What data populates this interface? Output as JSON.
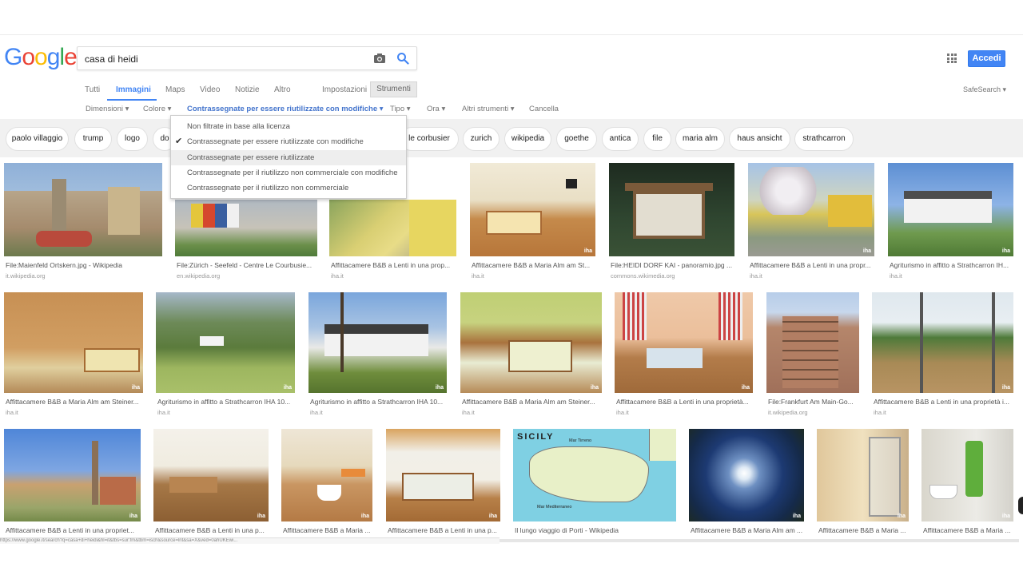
{
  "logo": {
    "text": "Google"
  },
  "search": {
    "value": "casa di heidi"
  },
  "header": {
    "signin_label": "Accedi"
  },
  "tabs": [
    {
      "label": "Tutti"
    },
    {
      "label": "Immagini"
    },
    {
      "label": "Maps"
    },
    {
      "label": "Video"
    },
    {
      "label": "Notizie"
    },
    {
      "label": "Altro"
    },
    {
      "label": "Impostazioni"
    },
    {
      "label": "Strumenti"
    }
  ],
  "safesearch": "SafeSearch ▾",
  "tools": {
    "dimensioni": "Dimensioni ▾",
    "colore": "Colore ▾",
    "license": "Contrassegnate per essere riutilizzate con modifiche ▾",
    "tipo": "Tipo ▾",
    "ora": "Ora ▾",
    "altri": "Altri strumenti ▾",
    "cancella": "Cancella"
  },
  "chips": [
    "paolo villaggio",
    "trump",
    "logo",
    "do",
    "le corbusier",
    "zurich",
    "wikipedia",
    "goethe",
    "antica",
    "file",
    "maria alm",
    "haus ansicht",
    "strathcarron"
  ],
  "dropdown": {
    "items": [
      "Non filtrate in base alla licenza",
      "Contrassegnate per essere riutilizzate con modifiche",
      "Contrassegnate per essere riutilizzate",
      "Contrassegnate per il riutilizzo non commerciale con modifiche",
      "Contrassegnate per il riutilizzo non commerciale"
    ],
    "checked_index": 1,
    "hover_index": 2
  },
  "results": [
    {
      "caption": "File:Maienfeld Ortskern.jpg - Wikipedia",
      "source": "it.wikipedia.org"
    },
    {
      "caption": "File:Zürich - Seefeld - Centre Le Courbusie...",
      "source": "en.wikipedia.org"
    },
    {
      "caption": "Affittacamere B&B a Lenti in una prop...",
      "source": "iha.it"
    },
    {
      "caption": "Affittacamere B&B a Maria Alm am St...",
      "source": "iha.it"
    },
    {
      "caption": "File:HEIDI DORF KAI - panoramio.jpg ...",
      "source": "commons.wikimedia.org"
    },
    {
      "caption": "Affittacamere B&B a Lenti in una propr...",
      "source": "iha.it"
    },
    {
      "caption": "Agriturismo in affitto a Strathcarron IH...",
      "source": "iha.it"
    },
    {
      "caption": "Affittacamere B&B a Maria Alm am Steiner...",
      "source": "iha.it"
    },
    {
      "caption": "Agriturismo in affitto a Strathcarron IHA 10...",
      "source": "iha.it"
    },
    {
      "caption": "Agriturismo in affitto a Strathcarron IHA 10...",
      "source": "iha.it"
    },
    {
      "caption": "Affittacamere B&B a Maria Alm am Steiner...",
      "source": "iha.it"
    },
    {
      "caption": "Affittacamere B&B a Lenti in una proprietà...",
      "source": "iha.it"
    },
    {
      "caption": "File:Frankfurt Am Main-Go...",
      "source": "it.wikipedia.org"
    },
    {
      "caption": "Affittacamere B&B a Lenti in una proprietà i...",
      "source": "iha.it"
    },
    {
      "caption": "Affittacamere B&B a Lenti in una propriet...",
      "source": ""
    },
    {
      "caption": "Affittacamere B&B a Lenti in una p...",
      "source": ""
    },
    {
      "caption": "Affittacamere B&B a Maria ...",
      "source": ""
    },
    {
      "caption": "Affittacamere B&B a Lenti in una p...",
      "source": ""
    },
    {
      "caption": "Il lungo viaggio di Porti - Wikipedia",
      "source": ""
    },
    {
      "caption": "Affittacamere B&B a Maria Alm am ...",
      "source": ""
    },
    {
      "caption": "Affittacamere B&B a Maria ...",
      "source": ""
    },
    {
      "caption": "Affittacamere B&B a Maria ...",
      "source": ""
    }
  ],
  "map_labels": {
    "title": "SICILY",
    "sea_north": "Mar Tirreno",
    "sea_south": "Mar Mediterraneo"
  },
  "watermark": "iha",
  "status_url": "https://www.google.it/search?q=casa+di+heidi&hl=it&tbs=sur:fm&tbm=isch&source=lnt&sa=X&ved=0ahUKEwi..."
}
